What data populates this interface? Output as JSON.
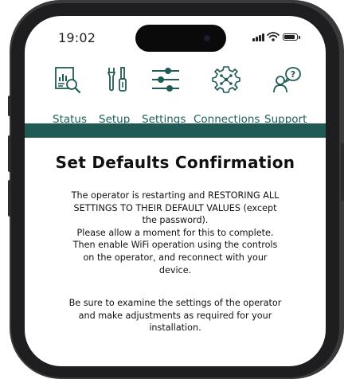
{
  "status_bar": {
    "time": "19:02"
  },
  "nav": {
    "items": [
      {
        "label": "Status",
        "icon": "status-icon"
      },
      {
        "label": "Setup",
        "icon": "tools-icon"
      },
      {
        "label": "Settings",
        "icon": "sliders-icon",
        "active": true
      },
      {
        "label": "Connections",
        "icon": "network-icon"
      },
      {
        "label": "Support",
        "icon": "support-icon"
      }
    ]
  },
  "colors": {
    "accent": "#1f5a55",
    "nav_text": "#1f5f5a"
  },
  "content": {
    "title": "Set Defaults Confirmation",
    "paragraph1": "The operator is restarting and RESTORING ALL SETTINGS TO THEIR DEFAULT VALUES (except the password). Please allow a moment for this to complete. Then enable WiFi operation using the controls on the operator, and reconnect with your device.",
    "paragraph1_lines": [
      "The operator is restarting and RESTORING ALL",
      "SETTINGS TO THEIR DEFAULT VALUES (except",
      "the password).",
      "Please allow a moment for this to complete.",
      "Then enable WiFi operation using the controls",
      "on the operator, and reconnect with your",
      "device."
    ],
    "paragraph2_lines": [
      "Be sure to examine the settings of the operator",
      "and make adjustments as required for your",
      "installation."
    ]
  }
}
